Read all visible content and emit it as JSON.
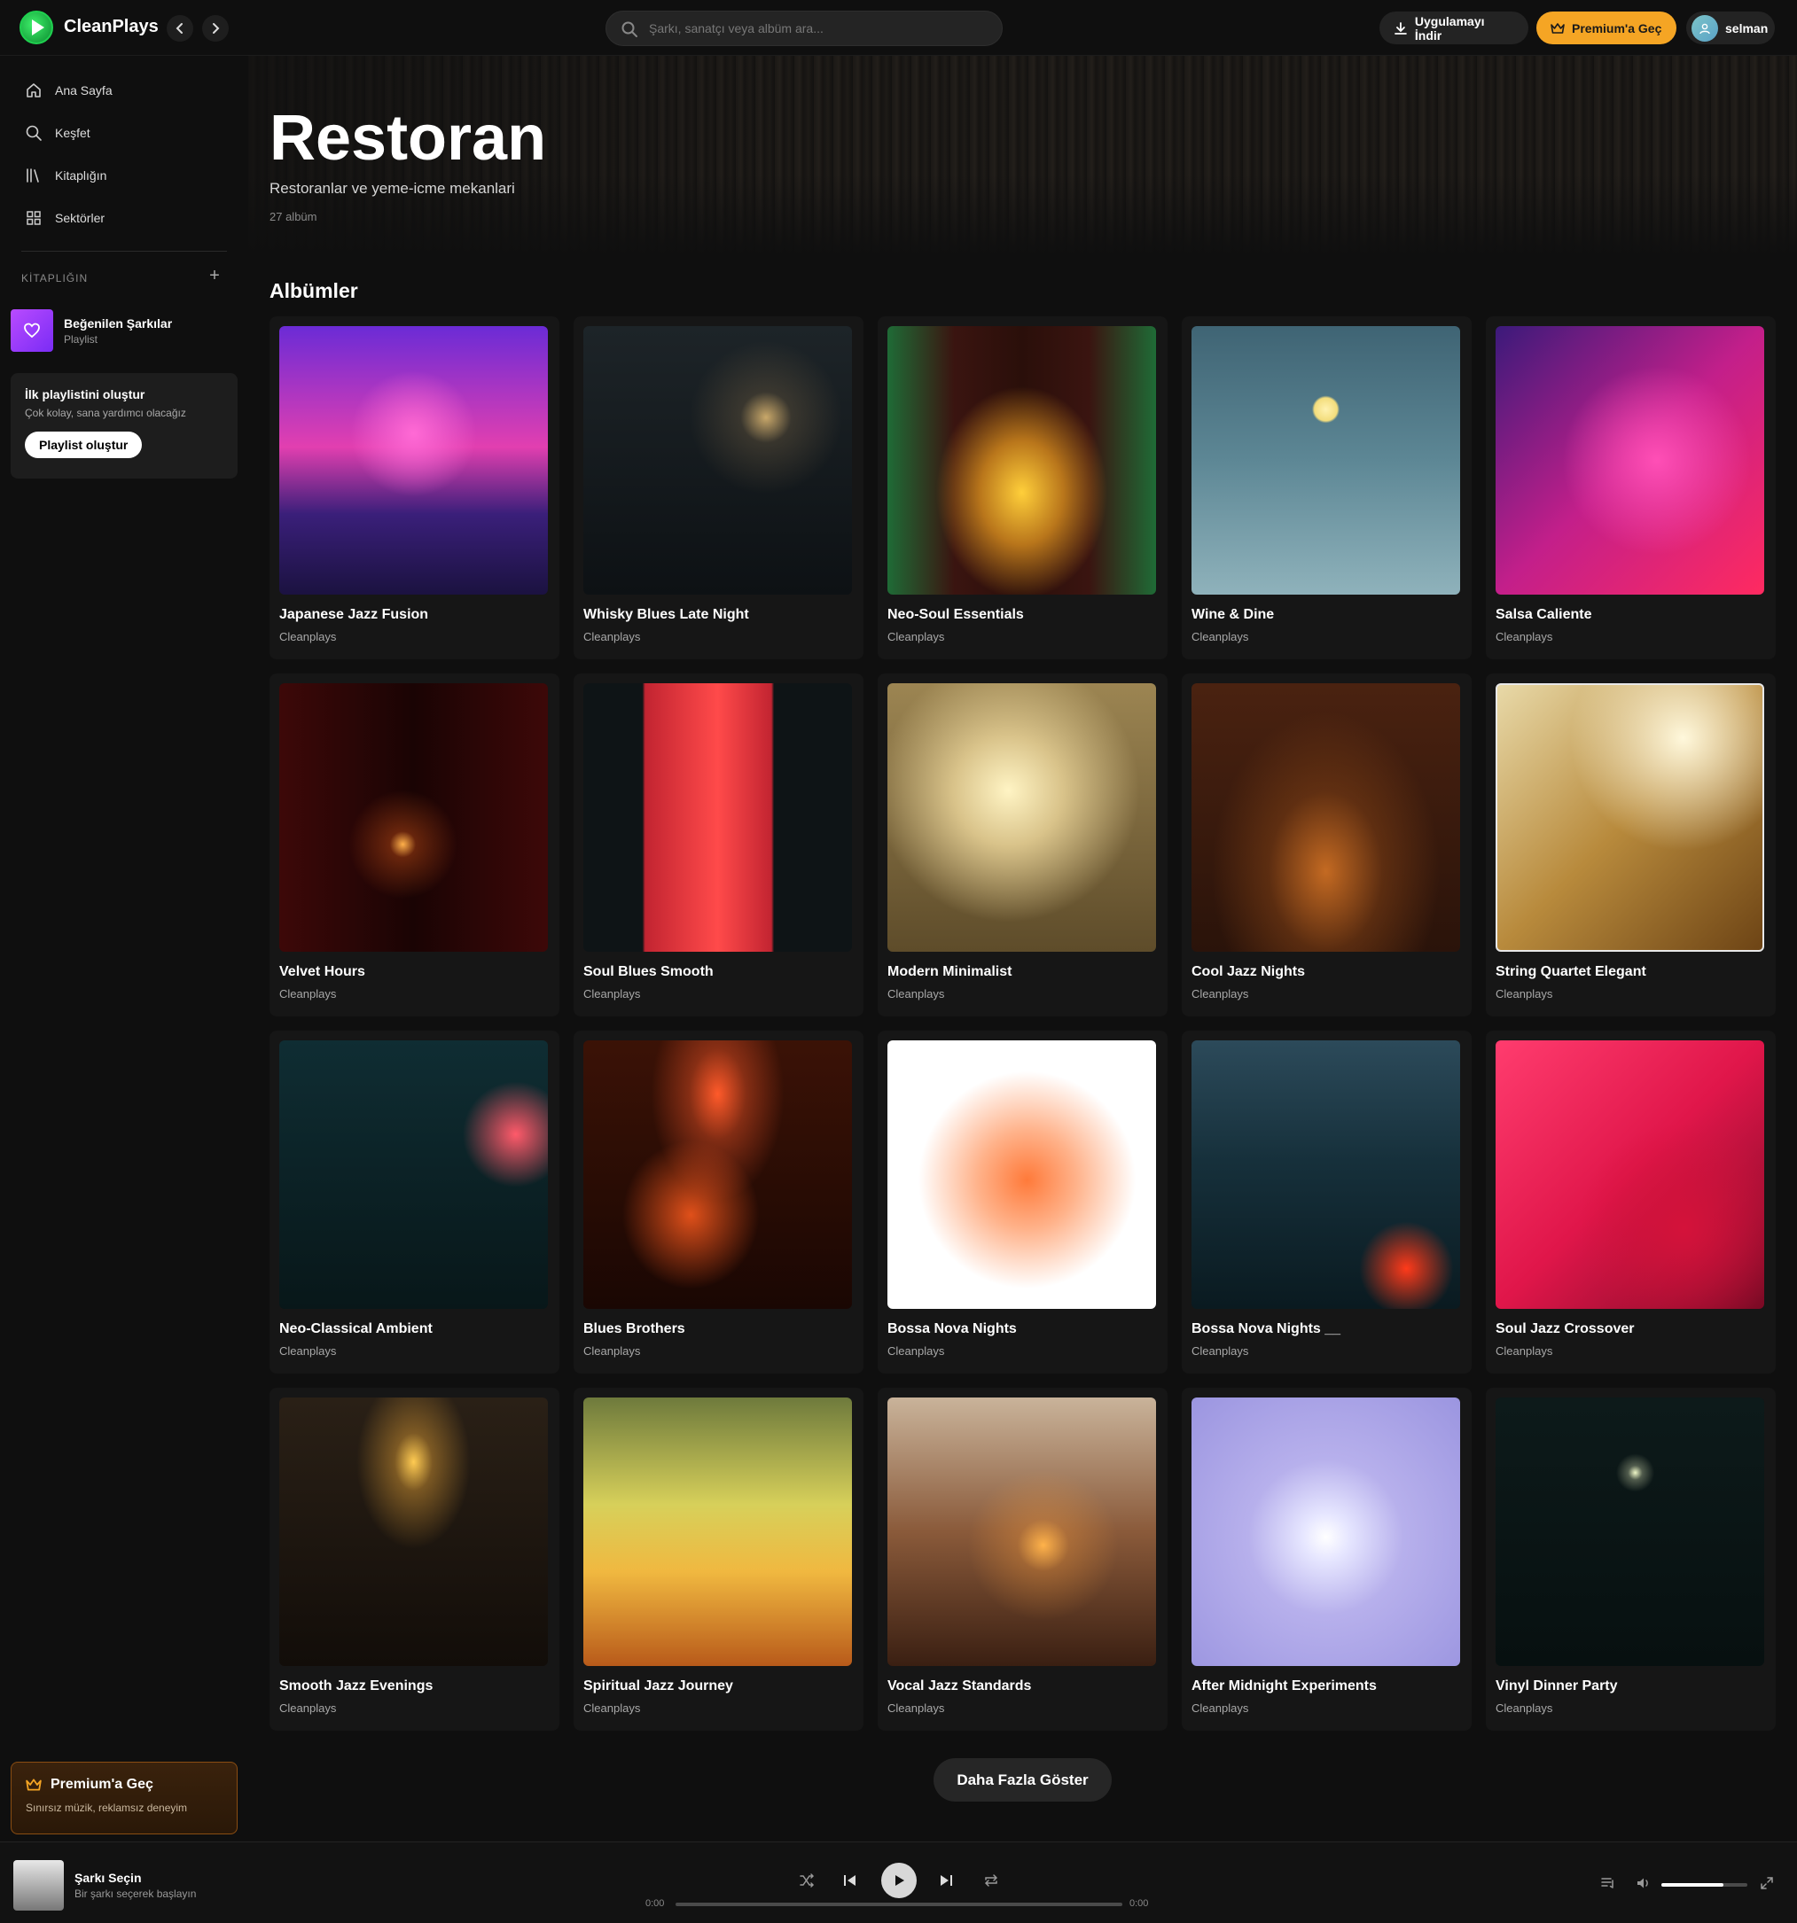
{
  "app": {
    "name": "CleanPlays"
  },
  "search": {
    "placeholder": "Şarkı, sanatçı veya albüm ara..."
  },
  "header": {
    "download_label": "Uygulamayı İndir",
    "premium_label": "Premium'a Geç",
    "user_name": "selman"
  },
  "sidebar": {
    "items": [
      {
        "label": "Ana Sayfa",
        "icon": "home-icon"
      },
      {
        "label": "Keşfet",
        "icon": "search-icon"
      },
      {
        "label": "Kitaplığın",
        "icon": "library-icon"
      },
      {
        "label": "Sektörler",
        "icon": "grid-icon"
      }
    ],
    "library_heading": "KİTAPLIĞIN",
    "liked": {
      "title": "Beğenilen Şarkılar",
      "subtitle": "Playlist"
    },
    "create": {
      "title": "İlk playlistini oluştur",
      "subtitle": "Çok kolay, sana yardımcı olacağız",
      "button": "Playlist oluştur"
    },
    "premium": {
      "title": "Premium'a Geç",
      "subtitle": "Sınırsız müzik, reklamsız deneyim"
    }
  },
  "hero": {
    "title": "Restoran",
    "subtitle": "Restoranlar ve yeme-icme mekanlari",
    "count": "27 albüm"
  },
  "albums_heading": "Albümler",
  "albums": [
    {
      "title": "Japanese Jazz Fusion",
      "artist": "Cleanplays"
    },
    {
      "title": "Whisky Blues Late Night",
      "artist": "Cleanplays"
    },
    {
      "title": "Neo-Soul Essentials",
      "artist": "Cleanplays"
    },
    {
      "title": "Wine & Dine",
      "artist": "Cleanplays"
    },
    {
      "title": "Salsa Caliente",
      "artist": "Cleanplays"
    },
    {
      "title": "Velvet Hours",
      "artist": "Cleanplays"
    },
    {
      "title": "Soul Blues Smooth",
      "artist": "Cleanplays"
    },
    {
      "title": "Modern Minimalist",
      "artist": "Cleanplays"
    },
    {
      "title": "Cool Jazz Nights",
      "artist": "Cleanplays"
    },
    {
      "title": "String Quartet Elegant",
      "artist": "Cleanplays"
    },
    {
      "title": "Neo-Classical Ambient",
      "artist": "Cleanplays"
    },
    {
      "title": "Blues Brothers",
      "artist": "Cleanplays"
    },
    {
      "title": "Bossa Nova Nights",
      "artist": "Cleanplays"
    },
    {
      "title": "Bossa Nova Nights __",
      "artist": "Cleanplays"
    },
    {
      "title": "Soul Jazz Crossover",
      "artist": "Cleanplays"
    },
    {
      "title": "Smooth Jazz Evenings",
      "artist": "Cleanplays"
    },
    {
      "title": "Spiritual Jazz Journey",
      "artist": "Cleanplays"
    },
    {
      "title": "Vocal Jazz Standards",
      "artist": "Cleanplays"
    },
    {
      "title": "After Midnight Experiments",
      "artist": "Cleanplays"
    },
    {
      "title": "Vinyl Dinner Party",
      "artist": "Cleanplays"
    }
  ],
  "more_button": "Daha Fazla Göster",
  "player": {
    "title": "Şarkı Seçin",
    "subtitle": "Bir şarkı seçerek başlayın",
    "current_time": "0:00",
    "total_time": "0:00",
    "volume": 0.72
  },
  "colors": {
    "accent": "#f5a524",
    "brand": "#1fd14f",
    "background": "#0f0f0f"
  }
}
